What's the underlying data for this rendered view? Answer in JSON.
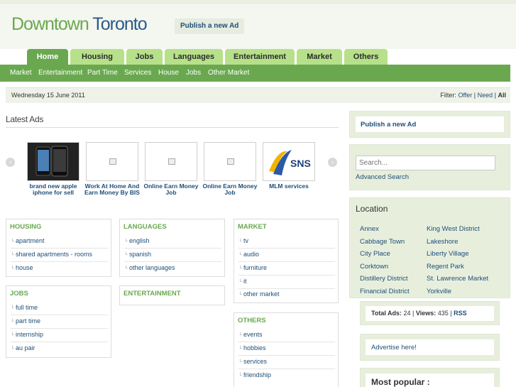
{
  "header": {
    "logo_part1": "Downtown",
    "logo_part2": "Toronto",
    "publish_label": "Publish a new Ad"
  },
  "tabs": [
    {
      "label": "Home",
      "active": true
    },
    {
      "label": "Housing"
    },
    {
      "label": "Jobs"
    },
    {
      "label": "Languages"
    },
    {
      "label": "Entertainment"
    },
    {
      "label": "Market"
    },
    {
      "label": "Others"
    }
  ],
  "subnav": [
    "Market",
    "Entertainment",
    "Part Time",
    "Services",
    "House",
    "Jobs",
    "Other Market"
  ],
  "datebar": {
    "date": "Wednesday 15 June 2011",
    "filter_label": "Filter",
    "offer": "Offer",
    "need": "Need",
    "all": "All"
  },
  "latest_title": "Latest Ads",
  "latest_ads": [
    {
      "title": "brand new apple iphone for sell",
      "image": "phone-photo"
    },
    {
      "title": "Work At Home And Earn Money By BIS",
      "image": "placeholder"
    },
    {
      "title": "Online Earn Money Job",
      "image": "placeholder"
    },
    {
      "title": "Online Earn Money Job",
      "image": "placeholder"
    },
    {
      "title": "MLM services",
      "image": "sns-logo",
      "logo_text": "SNS"
    }
  ],
  "categories": {
    "housing": {
      "title": "HOUSING",
      "items": [
        "apartment",
        "shared apartments - rooms",
        "house"
      ]
    },
    "jobs": {
      "title": "JOBS",
      "items": [
        "full time",
        "part time",
        "internship",
        "au pair"
      ]
    },
    "languages": {
      "title": "LANGUAGES",
      "items": [
        "english",
        "spanish",
        "other languages"
      ]
    },
    "entertainment": {
      "title": "ENTERTAINMENT",
      "items": []
    },
    "market": {
      "title": "MARKET",
      "items": [
        "tv",
        "audio",
        "furniture",
        "it",
        "other market"
      ]
    },
    "others": {
      "title": "OTHERS",
      "items": [
        "events",
        "hobbies",
        "services",
        "friendship"
      ]
    }
  },
  "sidebar": {
    "publish_label": "Publish a new Ad",
    "search_placeholder": "Search...",
    "advanced_search": "Advanced Search",
    "location_title": "Location",
    "locations_left": [
      "Annex",
      "Cabbage Town",
      "City Place",
      "Corktown",
      "Distillery District",
      "Financial District"
    ],
    "locations_right": [
      "King West District",
      "Lakeshore",
      "Liberty Village",
      "Regent Park",
      "St. Lawrence Market",
      "Yorkville"
    ],
    "stats": {
      "total_label": "Total Ads:",
      "total": "24",
      "views_label": "Views:",
      "views": "435",
      "rss": "RSS"
    },
    "advertise": "Advertise here!",
    "most_popular": "Most popular :"
  },
  "colors": {
    "accent_green": "#6aa84f",
    "tab_green": "#b7e08a",
    "link_blue": "#1f4e79"
  }
}
